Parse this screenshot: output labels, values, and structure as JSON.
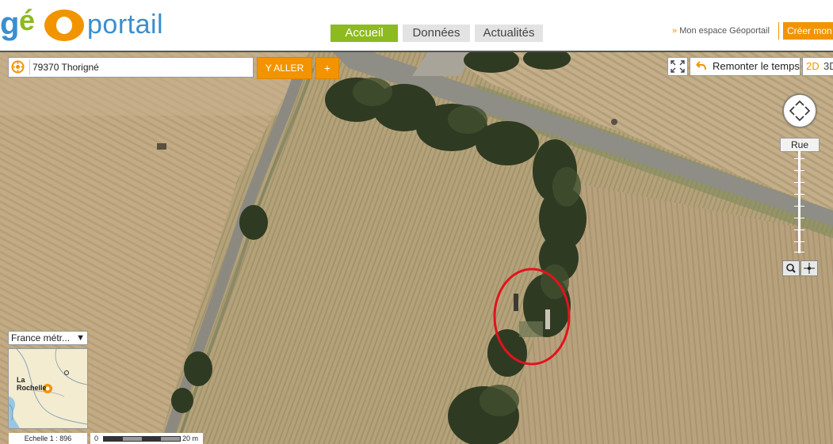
{
  "header": {
    "logo_text": "géoportail",
    "nav_tabs": [
      {
        "label": "Accueil",
        "active": true
      },
      {
        "label": "Données",
        "active": false
      },
      {
        "label": "Actualités",
        "active": false
      }
    ],
    "mon_espace_prefix": "»",
    "mon_espace_label": "Mon espace Géoportail",
    "creer_label": "Créer mon"
  },
  "search": {
    "value": "79370 Thorigné",
    "go_label": "Y ALLER",
    "add_label": "+"
  },
  "toolbar": {
    "remonter_label": "Remonter le temps",
    "view_2d": "2D",
    "view_3d": "3D"
  },
  "zoom": {
    "level_label": "Rue"
  },
  "overview": {
    "region_select": "France métr...",
    "city_label_line1": "La",
    "city_label_line2": "Rochelle"
  },
  "scale": {
    "echelle_label": "Echelle 1 :  896",
    "bar_zero": "0",
    "bar_distance": "20 m"
  },
  "colors": {
    "accent_orange": "#f29400",
    "accent_green": "#8dba1e",
    "logo_blue": "#3a8fcf",
    "highlight_circle": "#e0141e"
  },
  "icons": [
    "location-target-icon",
    "fullscreen-icon",
    "undo-arrow-icon",
    "pan-navigation-icon",
    "magnifier-icon",
    "crosshair-icon",
    "dropdown-arrow-icon"
  ]
}
